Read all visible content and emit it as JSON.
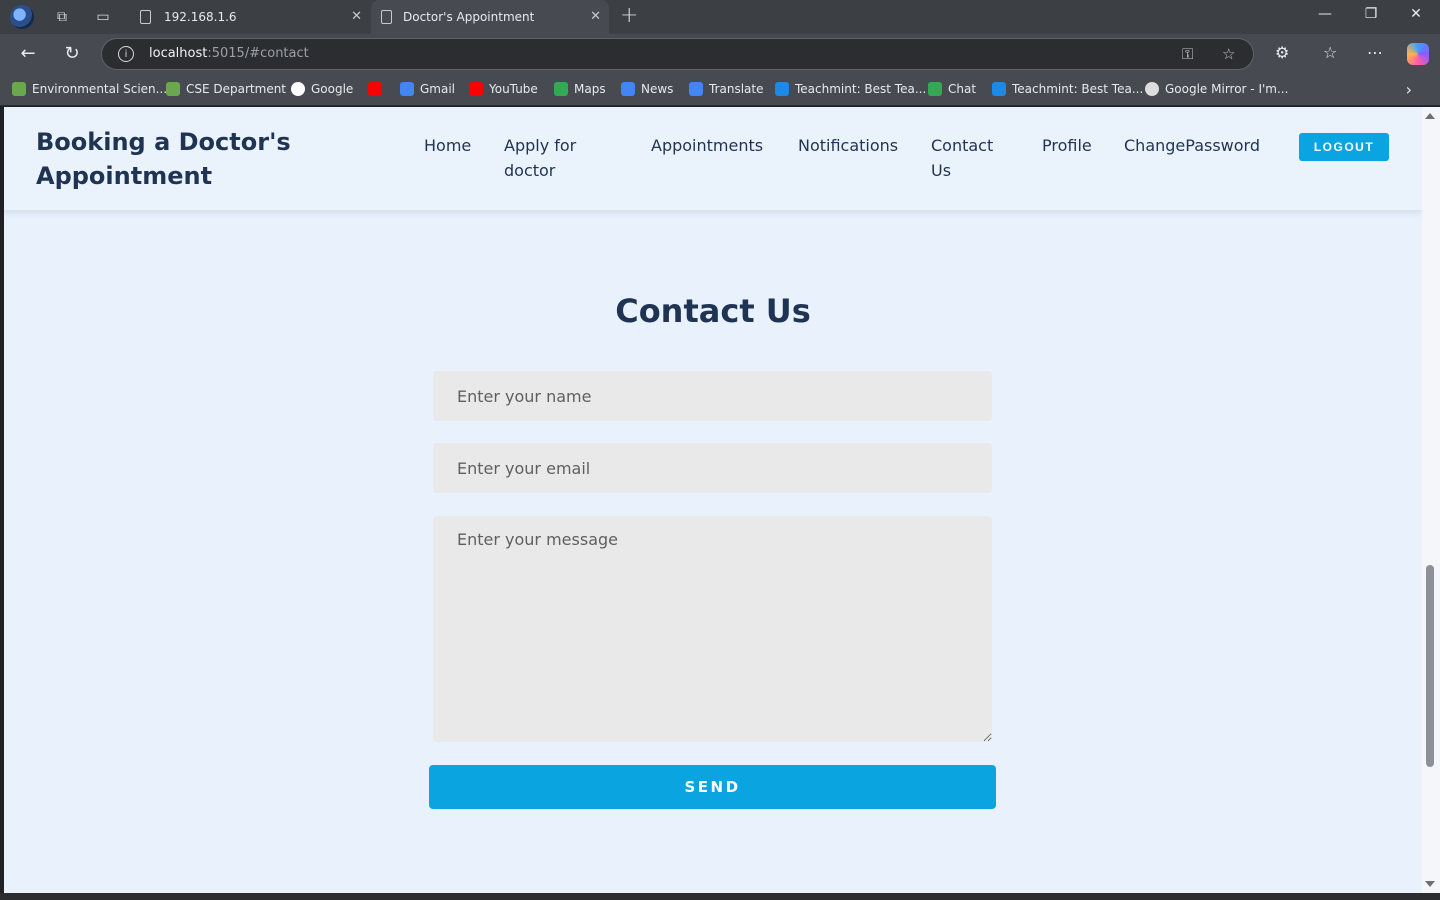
{
  "browser": {
    "tabs": [
      {
        "title": "192.168.1.6"
      },
      {
        "title": "Doctor's Appointment"
      }
    ],
    "url_host": "localhost",
    "url_path": ":5015/#contact",
    "bookmarks": [
      {
        "label": "Environmental Scien...",
        "color": "#6aa84f"
      },
      {
        "label": "CSE Department",
        "color": "#6aa84f"
      },
      {
        "label": "Google",
        "color": "#ffffff"
      },
      {
        "label": "",
        "color": "#ff0000"
      },
      {
        "label": "Gmail",
        "color": "#4285f4"
      },
      {
        "label": "YouTube",
        "color": "#ff0000"
      },
      {
        "label": "Maps",
        "color": "#34a853"
      },
      {
        "label": "News",
        "color": "#4285f4"
      },
      {
        "label": "Translate",
        "color": "#4285f4"
      },
      {
        "label": "Teachmint: Best Tea...",
        "color": "#1e88e5"
      },
      {
        "label": "Chat",
        "color": "#34a853"
      },
      {
        "label": "Teachmint: Best Tea...",
        "color": "#1e88e5"
      },
      {
        "label": "Google Mirror - I'm...",
        "color": "#dddddd"
      }
    ]
  },
  "header": {
    "brand": "Booking a Doctor's Appointment",
    "nav": [
      {
        "label": "Home"
      },
      {
        "label": "Apply for doctor"
      },
      {
        "label": "Appointments"
      },
      {
        "label": "Notifications"
      },
      {
        "label": "Contact Us"
      },
      {
        "label": "Profile"
      },
      {
        "label": "ChangePassword"
      }
    ],
    "logout_label": "LOGOUT"
  },
  "contact": {
    "title": "Contact Us",
    "name_placeholder": "Enter your name",
    "email_placeholder": "Enter your email",
    "message_placeholder": "Enter your message",
    "send_label": "SEND"
  },
  "colors": {
    "accent": "#0aa5e0",
    "heading": "#1f3452",
    "page_bg": "#e8f1fc",
    "field_bg": "#e9e9e9"
  }
}
